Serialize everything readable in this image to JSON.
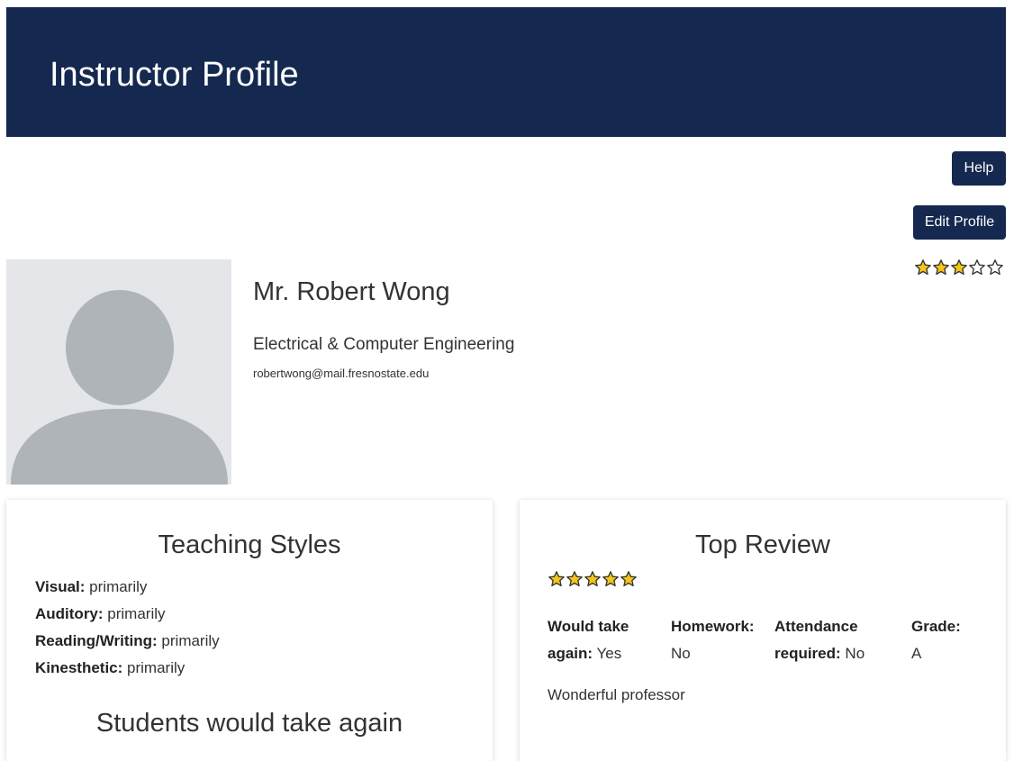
{
  "header": {
    "title": "Instructor Profile",
    "background": "#15284f"
  },
  "buttons": {
    "help": "Help",
    "edit_profile": "Edit Profile"
  },
  "profile": {
    "name": "Mr. Robert Wong",
    "department": "Electrical & Computer Engineering",
    "email": "robertwong@mail.fresnostate.edu",
    "rating": 3,
    "rating_max": 5,
    "avatar_icon": "default-user-avatar-icon"
  },
  "teaching_styles": {
    "title": "Teaching Styles",
    "items": [
      {
        "label": "Visual:",
        "value": "primarily"
      },
      {
        "label": "Auditory:",
        "value": "primarily"
      },
      {
        "label": "Reading/Writing:",
        "value": "primarily"
      },
      {
        "label": "Kinesthetic:",
        "value": "primarily"
      }
    ],
    "next_section_title": "Students would take again"
  },
  "top_review": {
    "title": "Top Review",
    "rating": 5,
    "rating_max": 5,
    "would_take_again": {
      "label_line1": "Would take",
      "label_line2": "again:",
      "value": "Yes"
    },
    "homework": {
      "label": "Homework:",
      "value": "No"
    },
    "attendance": {
      "label_line1": "Attendance",
      "label_line2": "required:",
      "value": "No"
    },
    "grade": {
      "label": "Grade:",
      "value": "A"
    },
    "comment": "Wonderful professor"
  },
  "colors": {
    "star_fill": "#f5c518",
    "star_outline": "#333333",
    "primary": "#15284f"
  }
}
